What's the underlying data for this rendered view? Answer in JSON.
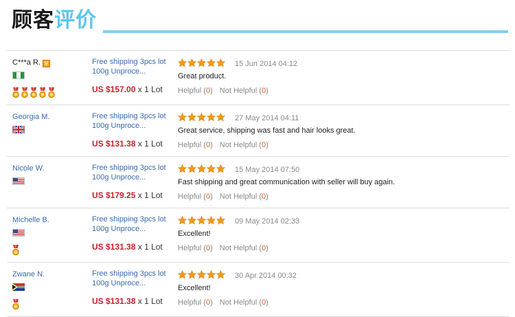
{
  "header": {
    "title_part1": "顾客",
    "title_part2": "评价"
  },
  "colors": {
    "accent": "#5cc6ef",
    "price": "#c8202e",
    "star": "#f39a1a",
    "link": "#3a6ab0",
    "count": "#d7621f"
  },
  "reviews": [
    {
      "name": "C***a R.",
      "vip_badge": "V",
      "flag": "nigeria-flag-icon",
      "medals": 5,
      "product_line1": "Free shipping 3pcs lot",
      "product_line2": "100g Unproce...",
      "price": "US $157.00",
      "quantity": "x 1 Lot",
      "rating": 5,
      "date": "15 Jun 2014 04:12",
      "comment": "Great product.",
      "helpful_label": "Helpful",
      "helpful_count": "0",
      "not_helpful_label": "Not Helpful",
      "not_helpful_count": "0"
    },
    {
      "name": "Georgia M.",
      "flag": "uk-flag-icon",
      "medals": 0,
      "product_line1": "Free shipping 3pcs lot",
      "product_line2": "100g Unproce...",
      "price": "US $131.38",
      "quantity": "x 1 Lot",
      "rating": 5,
      "date": "27 May 2014 04:11",
      "comment": "Great service, shipping was fast and hair looks great.",
      "helpful_label": "Helpful",
      "helpful_count": "0",
      "not_helpful_label": "Not Helpful",
      "not_helpful_count": "0"
    },
    {
      "name": "Nicole W.",
      "flag": "us-flag-icon",
      "medals": 0,
      "product_line1": "Free shipping 3pcs lot",
      "product_line2": "100g Unproce...",
      "price": "US $179.25",
      "quantity": "x 1 Lot",
      "rating": 5,
      "date": "15 May 2014 07:50",
      "comment": "Fast shipping and great communication with seller will buy again.",
      "helpful_label": "Helpful",
      "helpful_count": "0",
      "not_helpful_label": "Not Helpful",
      "not_helpful_count": "0"
    },
    {
      "name": "Michelle B.",
      "flag": "us-flag-icon",
      "medals": 1,
      "product_line1": "Free shipping 3pcs lot",
      "product_line2": "100g Unproce...",
      "price": "US $131.38",
      "quantity": "x 1 Lot",
      "rating": 5,
      "date": "09 May 2014 02:33",
      "comment": "Excellent!",
      "helpful_label": "Helpful",
      "helpful_count": "0",
      "not_helpful_label": "Not Helpful",
      "not_helpful_count": "0"
    },
    {
      "name": "Zwane N.",
      "flag": "south-africa-flag-icon",
      "medals": 1,
      "product_line1": "Free shipping 3pcs lot",
      "product_line2": "100g Unproce...",
      "price": "US $131.38",
      "quantity": "x 1 Lot",
      "rating": 5,
      "date": "30 Apr 2014 00:32",
      "comment": "Excellent!",
      "helpful_label": "Helpful",
      "helpful_count": "0",
      "not_helpful_label": "Not Helpful",
      "not_helpful_count": "0"
    }
  ]
}
